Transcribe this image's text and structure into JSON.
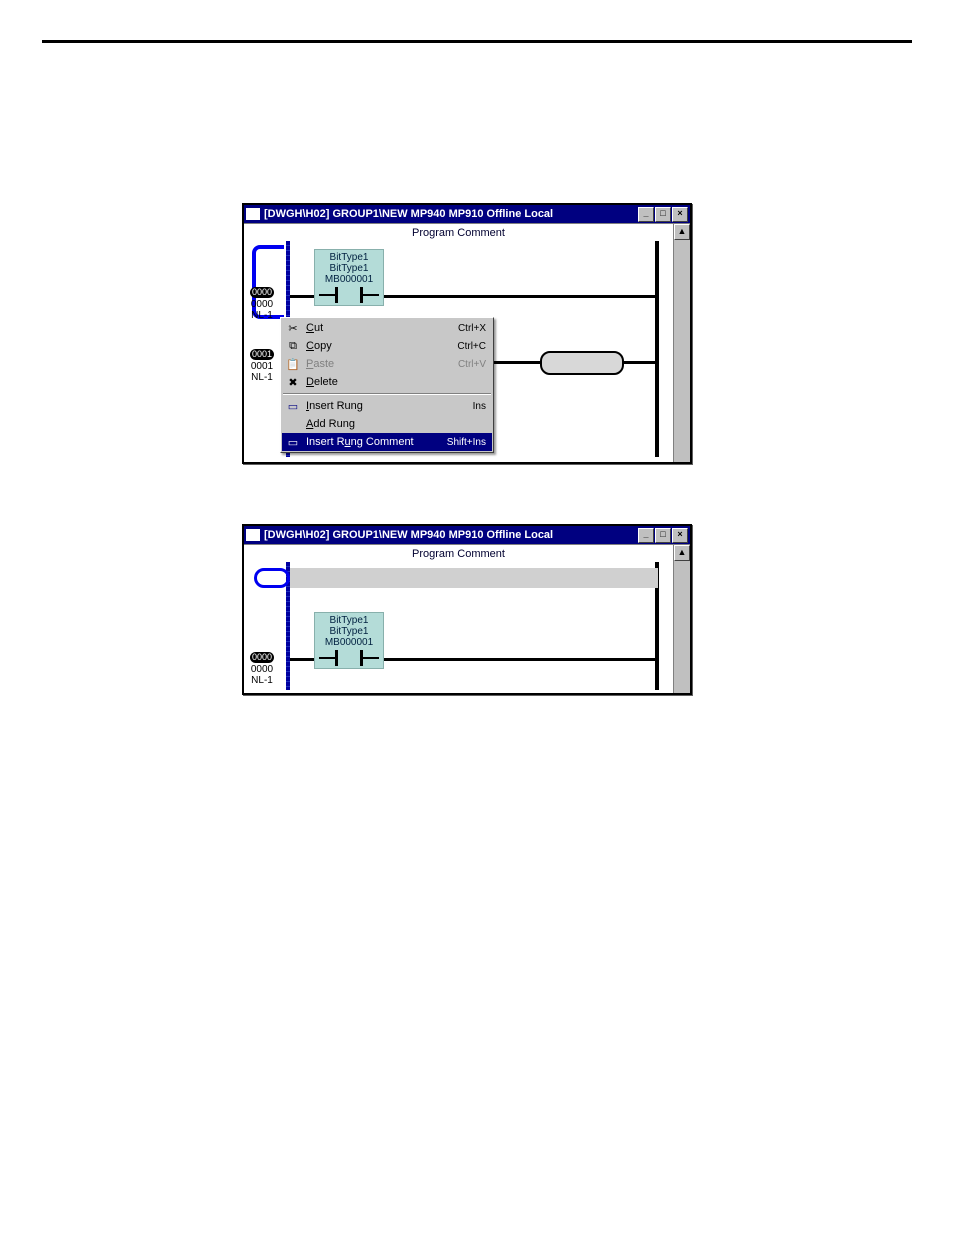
{
  "fig1": {
    "title": "[DWGH\\H02]   GROUP1\\NEW  MP940  MP910     Offline  Local",
    "program_comment": "Program Comment",
    "contact": {
      "l1": "BitType1",
      "l2": "BitType1",
      "addr": "MB000001"
    },
    "gutter0": {
      "bad": "0000",
      "a": "0000",
      "nl": "NL-1"
    },
    "gutter1": {
      "bad": "0001",
      "a": "0001",
      "nl": "NL-1"
    },
    "menu": {
      "cut": {
        "label": "Cut",
        "shortcut": "Ctrl+X"
      },
      "copy": {
        "label": "Copy",
        "shortcut": "Ctrl+C"
      },
      "paste": {
        "label": "Paste",
        "shortcut": "Ctrl+V"
      },
      "delete": {
        "label": "Delete"
      },
      "insertRung": {
        "label": "Insert Rung",
        "shortcut": "Ins"
      },
      "addRung": {
        "label": "Add Rung"
      },
      "insertRungComment": {
        "label": "Insert Rung Comment",
        "shortcut": "Shift+Ins"
      }
    },
    "winbtn": {
      "min": "_",
      "max": "□",
      "close": "×"
    },
    "scroll_arrow": "▲"
  },
  "fig2": {
    "title": "[DWGH\\H02]   GROUP1\\NEW  MP940  MP910     Offline  Local",
    "program_comment": "Program Comment",
    "contact": {
      "l1": "BitType1",
      "l2": "BitType1",
      "addr": "MB000001"
    },
    "gutter0": {
      "bad": "0000",
      "a": "0000",
      "nl": "NL-1"
    },
    "winbtn": {
      "min": "_",
      "max": "□",
      "close": "×"
    },
    "scroll_arrow": "▲"
  }
}
